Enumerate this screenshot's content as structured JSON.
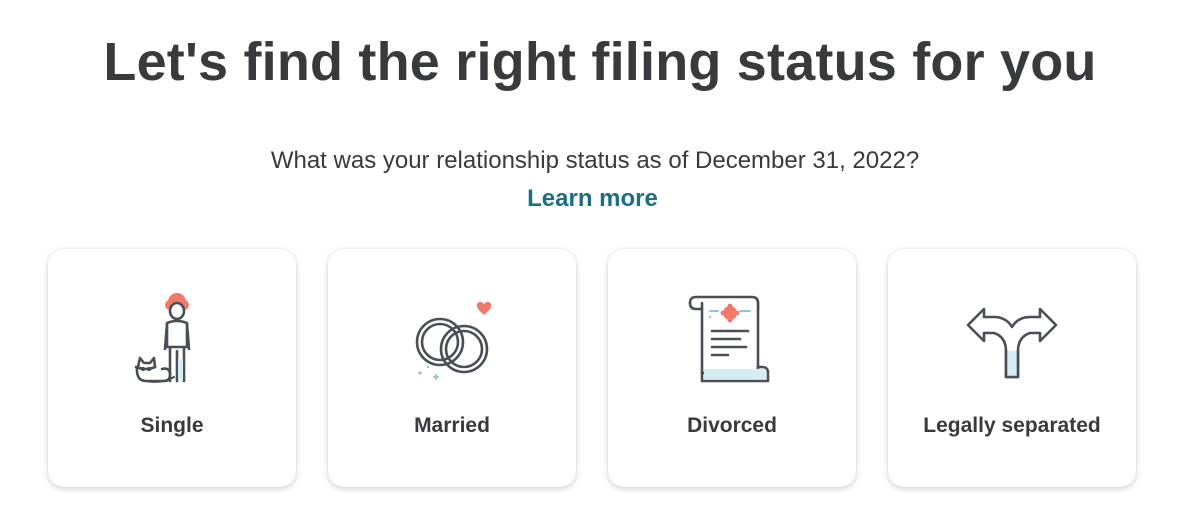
{
  "header": {
    "title": "Let's find the right filing status for you",
    "question": "What was your relationship status as of December 31, 2022?",
    "learn_more": "Learn more"
  },
  "options": [
    {
      "label": "Single",
      "icon": "person-with-cat-icon"
    },
    {
      "label": "Married",
      "icon": "wedding-rings-icon"
    },
    {
      "label": "Divorced",
      "icon": "certificate-scroll-icon"
    },
    {
      "label": "Legally separated",
      "icon": "split-arrow-icon"
    }
  ],
  "colors": {
    "heading": "#393a3d",
    "link": "#1c6e83",
    "accent": "#f2786a",
    "icon_stroke": "#4a4f57",
    "icon_fill_light": "#d6ecf3"
  }
}
